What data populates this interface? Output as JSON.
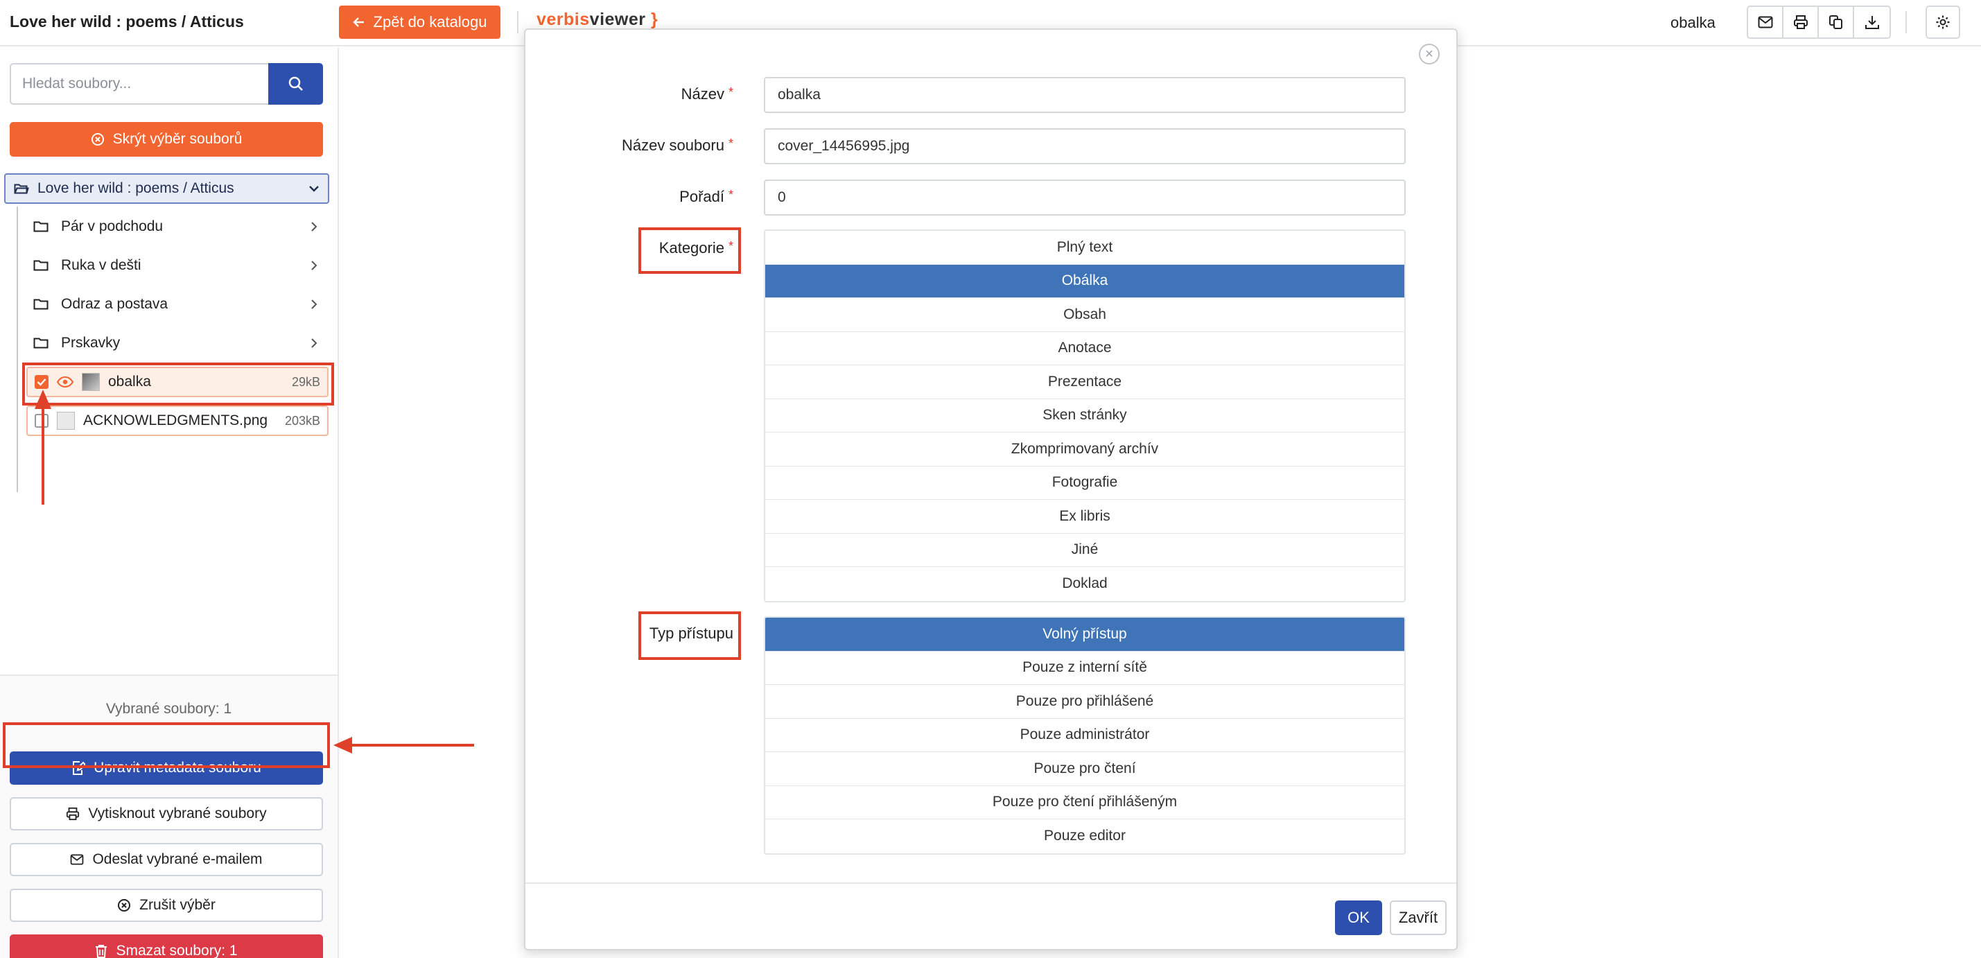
{
  "header": {
    "doc_title": "Love her wild : poems / Atticus",
    "back_button": "Zpět do katalogu",
    "logo_part1": "verbis",
    "logo_part2": "viewer",
    "logo_part3": "}",
    "current_file": "obalka",
    "icons": [
      "envelope-icon",
      "printer-icon",
      "copy-icon",
      "download-icon",
      "settings-icon"
    ]
  },
  "sidebar": {
    "search_placeholder": "Hledat soubory...",
    "hide_selection": "Skrýt výběr souborů",
    "root": "Love her wild : poems / Atticus",
    "folders": [
      "Pár v podchodu",
      "Ruka v dešti",
      "Odraz a postava",
      "Prskavky"
    ],
    "files": [
      {
        "name": "obalka",
        "size": "29kB",
        "checked": true
      },
      {
        "name": "ACKNOWLEDGMENTS.png",
        "size": "203kB",
        "checked": false
      }
    ],
    "selected_count": "Vybrané soubory: 1",
    "buttons": {
      "edit_metadata": "Upravit metadata souboru",
      "print": "Vytisknout vybrané soubory",
      "email": "Odeslat vybrané e-mailem",
      "cancel": "Zrušit výběr",
      "delete": "Smazat soubory: 1"
    }
  },
  "modal": {
    "fields": {
      "name_label": "Název",
      "name_value": "obalka",
      "filename_label": "Název souboru",
      "filename_value": "cover_14456995.jpg",
      "order_label": "Pořadí",
      "order_value": "0",
      "category_label": "Kategorie",
      "access_label": "Typ přístupu"
    },
    "required_mark": "*",
    "categories": [
      "Plný text",
      "Obálka",
      "Obsah",
      "Anotace",
      "Prezentace",
      "Sken stránky",
      "Zkomprimovaný archív",
      "Fotografie",
      "Ex libris",
      "Jiné",
      "Doklad"
    ],
    "selected_category": "Obálka",
    "access_types": [
      "Volný přístup",
      "Pouze z interní sítě",
      "Pouze pro přihlášené",
      "Pouze administrátor",
      "Pouze pro čtení",
      "Pouze pro čtení přihlášeným",
      "Pouze editor"
    ],
    "selected_access": "Volný přístup",
    "ok_button": "OK",
    "close_button": "Zavřít",
    "close_icon": "×"
  },
  "colors": {
    "accent_orange": "#f26430",
    "primary_blue": "#2d4fad",
    "list_active": "#3f75b8",
    "danger": "#dc3a47",
    "annotation_red": "#e0402a"
  }
}
